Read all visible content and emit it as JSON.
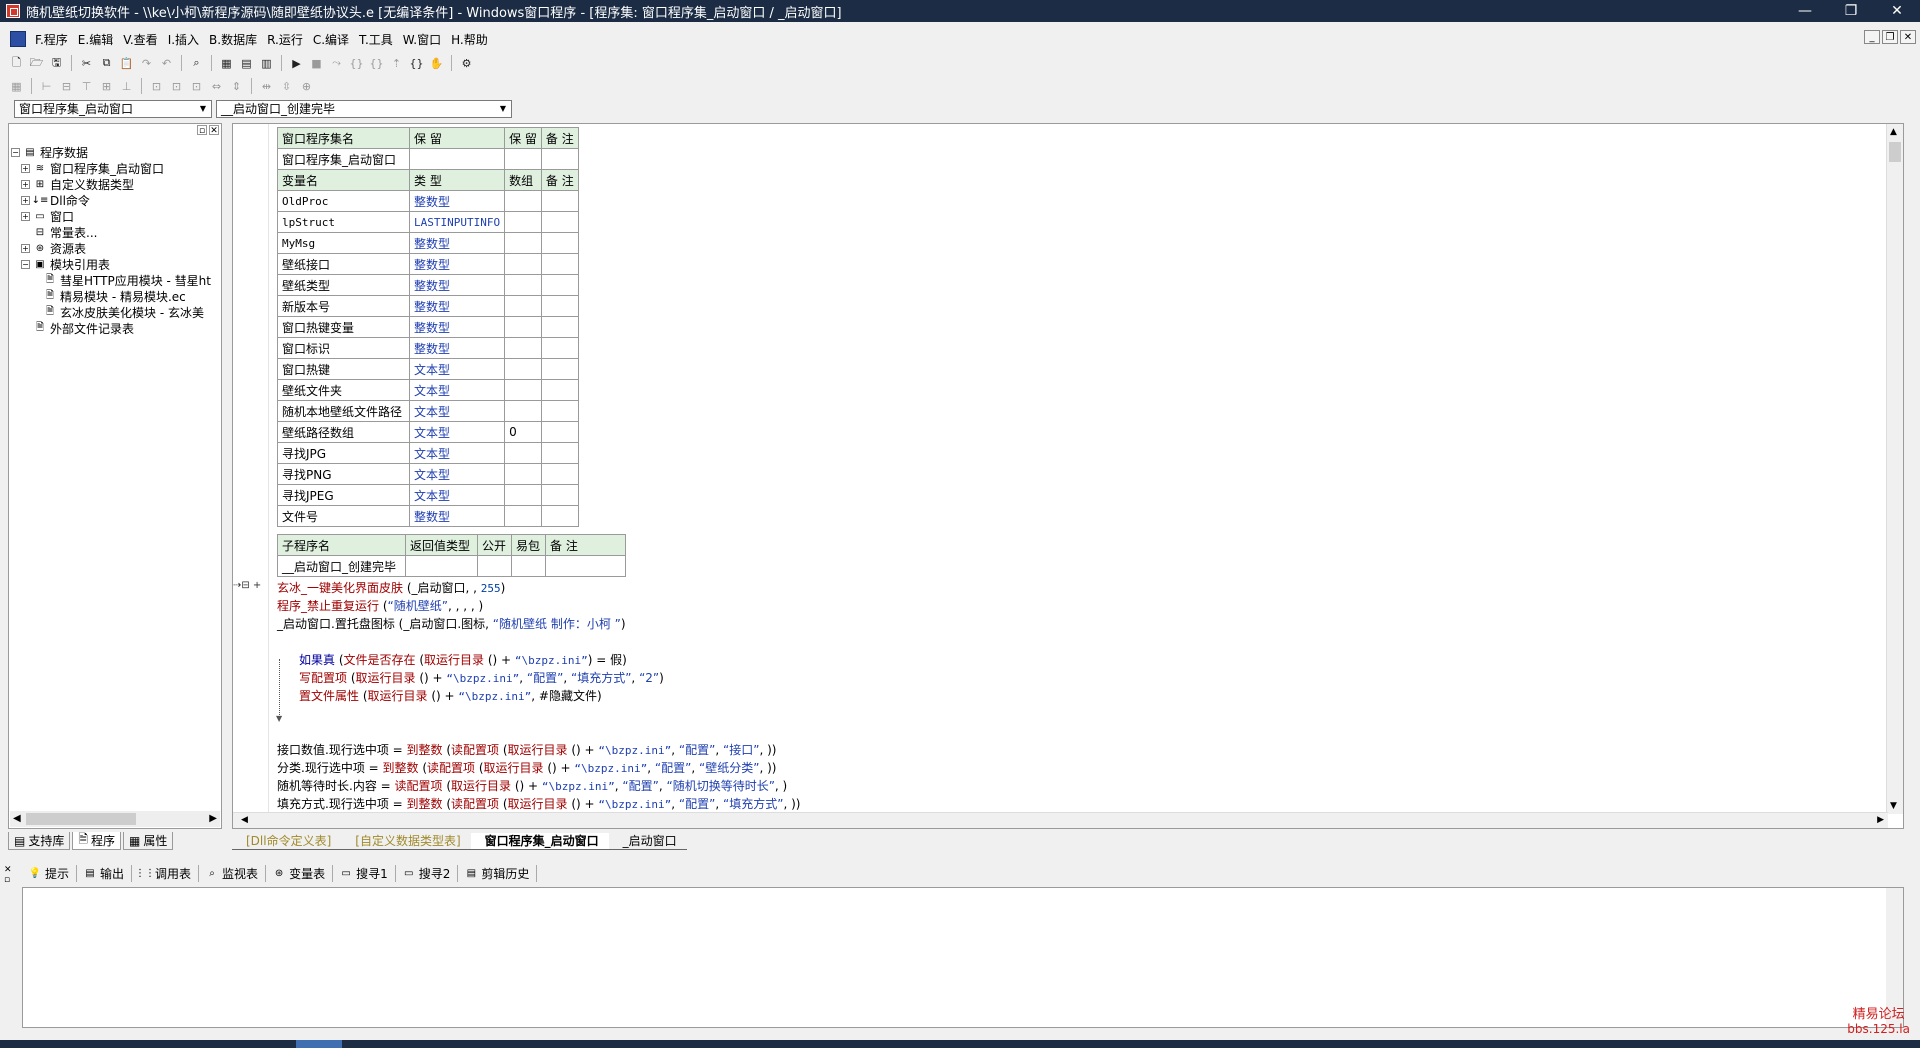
{
  "window": {
    "title": "随机壁纸切换软件 - \\\\ke\\小柯\\新程序源码\\随即壁纸协议头.e [无编译条件] - Windows窗口程序 - [程序集: 窗口程序集_启动窗口 / _启动窗口]",
    "minimize": "—",
    "restore": "❐",
    "close": "✕"
  },
  "menu": [
    "F.程序",
    "E.编辑",
    "V.查看",
    "I.插入",
    "B.数据库",
    "R.运行",
    "C.编译",
    "T.工具",
    "W.窗口",
    "H.帮助"
  ],
  "combos": {
    "left": "窗口程序集_启动窗口",
    "right": "__启动窗口_创建完毕"
  },
  "tree": [
    {
      "label": "程序数据",
      "icon": "folder-icon",
      "exp": "−",
      "indent": 0
    },
    {
      "label": "窗口程序集_启动窗口",
      "icon": "stack-icon",
      "exp": "+",
      "indent": 1
    },
    {
      "label": "自定义数据类型",
      "icon": "types-icon",
      "exp": "+",
      "indent": 1
    },
    {
      "label": "Dll命令",
      "icon": "dll-icon",
      "exp": "+",
      "indent": 1
    },
    {
      "label": "窗口",
      "icon": "window-icon",
      "exp": "+",
      "indent": 1
    },
    {
      "label": "常量表...",
      "icon": "constants-icon",
      "exp": "",
      "indent": 1
    },
    {
      "label": "资源表",
      "icon": "resources-icon",
      "exp": "+",
      "indent": 1
    },
    {
      "label": "模块引用表",
      "icon": "modules-icon",
      "exp": "−",
      "indent": 1
    },
    {
      "label": "彗星HTTP应用模块 - 彗星ht",
      "icon": "module-file-icon",
      "exp": "",
      "indent": 2
    },
    {
      "label": "精易模块 - 精易模块.ec",
      "icon": "module-file-icon",
      "exp": "",
      "indent": 2
    },
    {
      "label": "玄冰皮肤美化模块 - 玄冰美",
      "icon": "module-file-icon",
      "exp": "",
      "indent": 2
    },
    {
      "label": "外部文件记录表",
      "icon": "file-icon",
      "exp": "",
      "indent": 1
    }
  ],
  "left_tabs": [
    "支持库",
    "程序",
    "属性"
  ],
  "assembly_table": {
    "header": [
      "窗口程序集名",
      "保 留",
      "保 留",
      "备 注"
    ],
    "row": [
      "窗口程序集_启动窗口",
      "",
      "",
      ""
    ],
    "var_header": [
      "变量名",
      "类 型",
      "数组",
      "备 注"
    ],
    "vars": [
      [
        "OldProc",
        "整数型",
        "",
        ""
      ],
      [
        "lpStruct",
        "LASTINPUTINFO",
        "",
        ""
      ],
      [
        "MyMsg",
        "整数型",
        "",
        ""
      ],
      [
        "壁纸接口",
        "整数型",
        "",
        ""
      ],
      [
        "壁纸类型",
        "整数型",
        "",
        ""
      ],
      [
        "新版本号",
        "整数型",
        "",
        ""
      ],
      [
        "窗口热键变量",
        "整数型",
        "",
        ""
      ],
      [
        "窗口标识",
        "整数型",
        "",
        ""
      ],
      [
        "窗口热键",
        "文本型",
        "",
        ""
      ],
      [
        "壁纸文件夹",
        "文本型",
        "",
        ""
      ],
      [
        "随机本地壁纸文件路径",
        "文本型",
        "",
        ""
      ],
      [
        "壁纸路径数组",
        "文本型",
        "0",
        ""
      ],
      [
        "寻找JPG",
        "文本型",
        "",
        ""
      ],
      [
        "寻找PNG",
        "文本型",
        "",
        ""
      ],
      [
        "寻找JPEG",
        "文本型",
        "",
        ""
      ],
      [
        "文件号",
        "整数型",
        "",
        ""
      ]
    ]
  },
  "sub_table": {
    "header": [
      "子程序名",
      "返回值类型",
      "公开",
      "易包",
      "备 注"
    ],
    "row": [
      "__启动窗口_创建完毕",
      "",
      "",
      "",
      ""
    ]
  },
  "code": {
    "l1": [
      "玄冰_一键美化界面皮肤",
      " (_启动窗口, , ",
      "255",
      ")"
    ],
    "l2": [
      "程序_禁止重复运行",
      " (",
      "“随机壁纸”",
      ", , , , )"
    ],
    "l3": [
      "_启动窗口.置托盘图标",
      " (_启动窗口.图标, ",
      "“随机壁纸 制作：小柯 ”",
      ")"
    ],
    "l4": [
      "如果真",
      " (",
      "文件是否存在",
      " (",
      "取运行目录",
      " () + ",
      "“\\bzpz.ini”",
      ") = 假)"
    ],
    "l5": [
      "写配置项",
      " (",
      "取运行目录",
      " () + ",
      "“\\bzpz.ini”",
      ", ",
      "“配置”",
      ", ",
      "“填充方式”",
      ", ",
      "“2”",
      ")"
    ],
    "l6": [
      "置文件属性",
      " (",
      "取运行目录",
      " () + ",
      "“\\bzpz.ini”",
      ", #隐藏文件)"
    ],
    "l7": [
      "接口数值.现行选中项 = ",
      "到整数",
      " (",
      "读配置项",
      " (",
      "取运行目录",
      " () + ",
      "“\\bzpz.ini”",
      ", ",
      "“配置”",
      ", ",
      "“接口”",
      ", ))"
    ],
    "l8": [
      "分类.现行选中项 = ",
      "到整数",
      " (",
      "读配置项",
      " (",
      "取运行目录",
      " () + ",
      "“\\bzpz.ini”",
      ", ",
      "“配置”",
      ", ",
      "“壁纸分类”",
      ", ))"
    ],
    "l9": [
      "随机等待时长.内容 = ",
      "读配置项",
      " (",
      "取运行目录",
      " () + ",
      "“\\bzpz.ini”",
      ", ",
      "“配置”",
      ", ",
      "“随机切换等待时长”",
      ", )"
    ],
    "l10": [
      "填充方式.现行选中项 = ",
      "到整数",
      " (",
      "读配置项",
      " (",
      "取运行目录",
      " () + ",
      "“\\bzpz.ini”",
      ", ",
      "“配置”",
      ", ",
      "“填充方式”",
      ", ))"
    ]
  },
  "doc_tabs": [
    "[Dll命令定义表]",
    "[自定义数据类型表]",
    "窗口程序集_启动窗口",
    "_启动窗口"
  ],
  "bottom_tabs": [
    {
      "label": "提示",
      "icon": "bulb-icon"
    },
    {
      "label": "输出",
      "icon": "output-icon"
    },
    {
      "label": "调用表",
      "icon": "callstack-icon"
    },
    {
      "label": "监视表",
      "icon": "watch-icon"
    },
    {
      "label": "变量表",
      "icon": "variables-icon"
    },
    {
      "label": "搜寻1",
      "icon": "search1-icon"
    },
    {
      "label": "搜寻2",
      "icon": "search2-icon"
    },
    {
      "label": "剪辑历史",
      "icon": "clipboard-icon"
    }
  ],
  "watermark": {
    "line1": "精易论坛",
    "line2": "bbs.125.la"
  }
}
